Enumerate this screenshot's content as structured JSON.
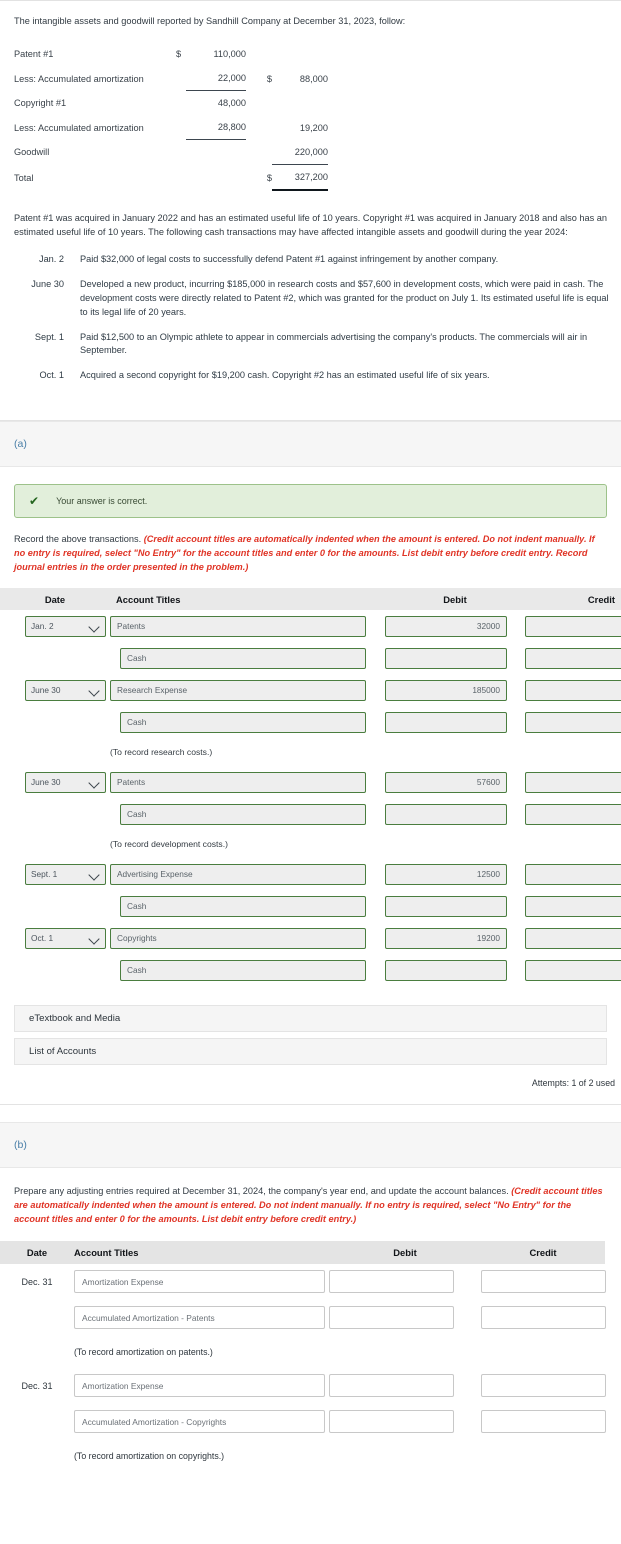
{
  "intro": "The intangible assets and goodwill reported by Sandhill Company at December 31, 2023, follow:",
  "balance_sheet": {
    "rows": [
      {
        "label": "Patent #1",
        "cur1": "$",
        "amt1": "110,000",
        "cur2": "",
        "amt2": ""
      },
      {
        "label": "Less: Accumulated amortization",
        "cur1": "",
        "amt1": "22,000",
        "cur2": "$",
        "amt2": "88,000"
      },
      {
        "label": "Copyright #1",
        "cur1": "",
        "amt1": "48,000",
        "cur2": "",
        "amt2": ""
      },
      {
        "label": "Less: Accumulated amortization",
        "cur1": "",
        "amt1": "28,800",
        "cur2": "",
        "amt2": "19,200"
      },
      {
        "label": "Goodwill",
        "cur1": "",
        "amt1": "",
        "cur2": "",
        "amt2": "220,000"
      },
      {
        "label": "Total",
        "cur1": "",
        "amt1": "",
        "cur2": "$",
        "amt2": "327,200"
      }
    ]
  },
  "paragraph": "Patent #1 was acquired in January 2022 and has an estimated useful life of 10 years. Copyright #1 was acquired in January 2018 and also has an estimated useful life of 10 years. The following cash transactions may have affected intangible assets and goodwill during the year 2024:",
  "transactions": [
    {
      "date": "Jan. 2",
      "desc": "Paid $32,000 of legal costs to successfully defend Patent #1 against infringement by another company."
    },
    {
      "date": "June 30",
      "desc": "Developed a new product, incurring $185,000 in research costs and $57,600 in development costs, which were paid in cash. The development costs were directly related to Patent #2, which was granted for the product on July 1. Its estimated useful life is equal to its legal life of 20 years."
    },
    {
      "date": "Sept. 1",
      "desc": "Paid $12,500 to an Olympic athlete to appear in commercials advertising the company's products. The commercials will air in September."
    },
    {
      "date": "Oct. 1",
      "desc": "Acquired a second copyright for $19,200 cash. Copyright #2 has an estimated useful life of six years."
    }
  ],
  "section_a": {
    "label": "(a)",
    "banner": {
      "text": "Your answer is correct.",
      "icon": "check-icon",
      "bg": "#e2efdb",
      "border": "#9dc28a",
      "color": "#24651f"
    },
    "instruction_plain": "Record the above transactions. ",
    "instruction_emphasis": "(Credit account titles are automatically indented when the amount is entered. Do not indent manually. If no entry is required, select \"No Entry\" for the account titles and enter 0 for the amounts. List debit entry before credit entry. Record journal entries in the order presented in the problem.)",
    "headers": {
      "date": "Date",
      "account": "Account Titles",
      "debit": "Debit",
      "credit": "Credit"
    },
    "entries": [
      {
        "kind": "row",
        "date": "Jan. 2",
        "has_select": true,
        "account": "Patents",
        "indent": false,
        "debit": "32000",
        "credit": ""
      },
      {
        "kind": "row",
        "date": "",
        "has_select": false,
        "account": "Cash",
        "indent": true,
        "debit": "",
        "credit": ""
      },
      {
        "kind": "row",
        "date": "June 30",
        "has_select": true,
        "account": "Research Expense",
        "indent": false,
        "debit": "185000",
        "credit": ""
      },
      {
        "kind": "row",
        "date": "",
        "has_select": false,
        "account": "Cash",
        "indent": true,
        "debit": "",
        "credit": ""
      },
      {
        "kind": "memo",
        "text": "(To record research costs.)"
      },
      {
        "kind": "row",
        "date": "June 30",
        "has_select": true,
        "account": "Patents",
        "indent": false,
        "debit": "57600",
        "credit": ""
      },
      {
        "kind": "row",
        "date": "",
        "has_select": false,
        "account": "Cash",
        "indent": true,
        "debit": "",
        "credit": ""
      },
      {
        "kind": "memo",
        "text": "(To record development costs.)"
      },
      {
        "kind": "row",
        "date": "Sept. 1",
        "has_select": true,
        "account": "Advertising Expense",
        "indent": false,
        "debit": "12500",
        "credit": ""
      },
      {
        "kind": "row",
        "date": "",
        "has_select": false,
        "account": "Cash",
        "indent": true,
        "debit": "",
        "credit": ""
      },
      {
        "kind": "row",
        "date": "Oct. 1",
        "has_select": true,
        "account": "Copyrights",
        "indent": false,
        "debit": "19200",
        "credit": ""
      },
      {
        "kind": "row",
        "date": "",
        "has_select": false,
        "account": "Cash",
        "indent": true,
        "debit": "",
        "credit": ""
      }
    ],
    "etextbook_label": "eTextbook and Media",
    "list_of_accounts_label": "List of Accounts",
    "attempts": "Attempts: 1 of 2 used"
  },
  "section_b": {
    "label": "(b)",
    "instruction_plain": "Prepare any adjusting entries required at December 31, 2024, the company's year end, and update the account balances. ",
    "instruction_emphasis": "(Credit account titles are automatically indented when the amount is entered. Do not indent manually. If no entry is required, select \"No Entry\" for the account titles and enter 0 for the amounts. List debit entry before credit entry.)",
    "headers": {
      "date": "Date",
      "account": "Account Titles",
      "debit": "Debit",
      "credit": "Credit"
    },
    "entries": [
      {
        "kind": "row",
        "date": "Dec. 31",
        "account": "Amortization Expense",
        "indent": false,
        "debit": "",
        "credit": ""
      },
      {
        "kind": "row",
        "date": "",
        "account": "Accumulated Amortization - Patents",
        "indent": true,
        "debit": "",
        "credit": ""
      },
      {
        "kind": "memo",
        "text": "(To record amortization on patents.)"
      },
      {
        "kind": "row",
        "date": "Dec. 31",
        "account": "Amortization Expense",
        "indent": false,
        "debit": "",
        "credit": ""
      },
      {
        "kind": "row",
        "date": "",
        "account": "Accumulated Amortization - Copyrights",
        "indent": true,
        "debit": "",
        "credit": ""
      },
      {
        "kind": "memo",
        "text": "(To record amortization on copyrights.)"
      }
    ]
  }
}
